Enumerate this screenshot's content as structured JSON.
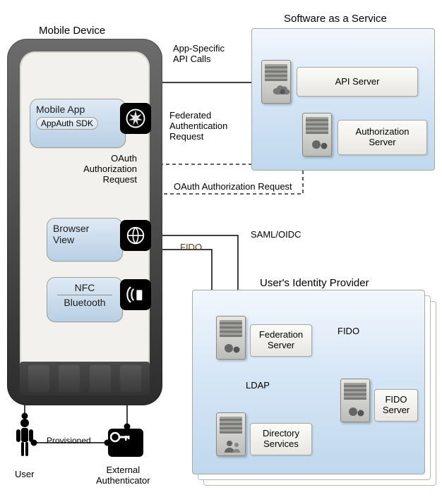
{
  "sections": {
    "mobile_device": "Mobile Device",
    "saas": "Software as a Service",
    "idp": "User's Identity Provider"
  },
  "phone": {
    "mobile_app": {
      "title": "Mobile App",
      "sdk": "AppAuth SDK"
    },
    "browser_view": {
      "title": "Browser\nView"
    },
    "nfc_bt": {
      "line1": "NFC",
      "line2": "Bluetooth"
    }
  },
  "saas_servers": {
    "api": "API Server",
    "authz": "Authorization\nServer"
  },
  "idp_servers": {
    "federation": "Federation\nServer",
    "directory": "Directory\nServices",
    "fido": "FIDO\nServer"
  },
  "flows": {
    "api_calls": "App-Specific\nAPI Calls",
    "fed_auth_req": "Federated\nAuthentication\nRequest",
    "oauth_req_local": "OAuth\nAuthorization\nRequest",
    "oauth_req_ext": "OAuth Authorization Request",
    "saml_oidc": "SAML/OIDC",
    "fido_browser": "FIDO",
    "fido_server": "FIDO",
    "ldap": "LDAP",
    "provisioned": "Provisioned"
  },
  "actors": {
    "user": "User",
    "external_auth": "External\nAuthenticator"
  }
}
